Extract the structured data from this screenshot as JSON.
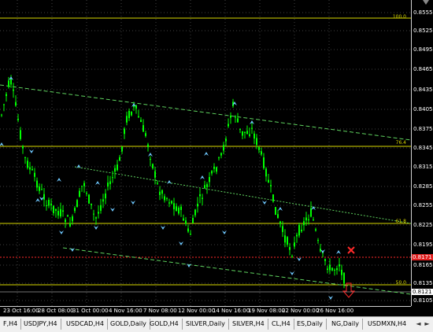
{
  "price_axis": {
    "labels": [
      "0.8555",
      "0.8525",
      "0.8495",
      "0.8465",
      "0.8435",
      "0.8405",
      "0.8375",
      "0.8345",
      "0.8315",
      "0.8285",
      "0.8255",
      "0.8225",
      "0.8195",
      "0.8165",
      "0.8135",
      "0.8105"
    ],
    "tag_high": "0.8171",
    "tag_current": "0.8121"
  },
  "fib_levels": {
    "l100": "100.0",
    "l764": "76.4",
    "l618": "61.8",
    "l500": "50.0"
  },
  "time_axis": {
    "labels": [
      "23 Oct 16:00",
      "28 Oct 08:00",
      "31 Oct 00:00",
      "4 Nov 16:00",
      "7 Nov 08:00",
      "12 Nov 00:00",
      "14 Nov 16:00",
      "19 Nov 08:00",
      "22 Nov 00:00",
      "26 Nov 16:00"
    ]
  },
  "tabs": {
    "items": [
      "F,H4",
      "USDJPY,H4",
      "USDCAD,H4",
      "GOLD,Daily",
      "GOLD,H4",
      "SILVER,Daily",
      "SILVER,H4",
      "CL,H4",
      "ES,Daily",
      "NG,Daily",
      "USDMXN,H4"
    ],
    "prev": "◄",
    "next": "►"
  },
  "colors": {
    "candle": "#00ff00",
    "fib": "#d8d800",
    "channel": "#5fd35f",
    "fractal": "#6fc8ff",
    "stop_red": "#ff2a2a",
    "grid": "#404040"
  }
}
